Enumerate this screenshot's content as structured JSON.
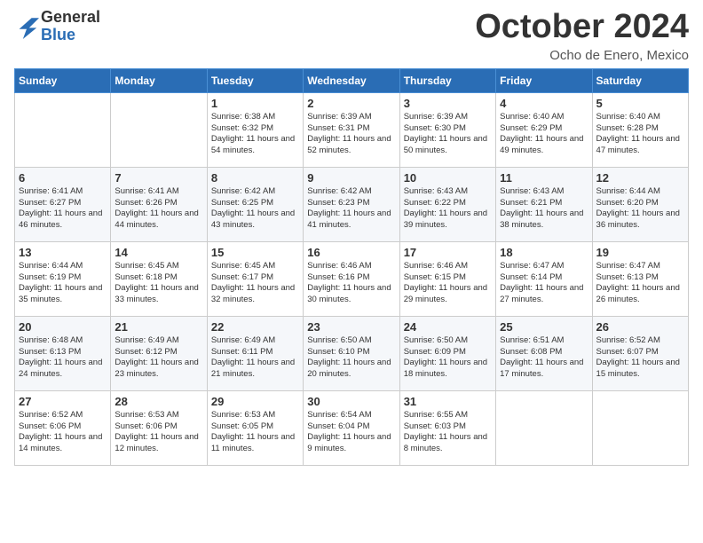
{
  "logo": {
    "general": "General",
    "blue": "Blue"
  },
  "header": {
    "month": "October 2024",
    "location": "Ocho de Enero, Mexico"
  },
  "weekdays": [
    "Sunday",
    "Monday",
    "Tuesday",
    "Wednesday",
    "Thursday",
    "Friday",
    "Saturday"
  ],
  "weeks": [
    [
      {
        "day": "",
        "sunrise": "",
        "sunset": "",
        "daylight": ""
      },
      {
        "day": "",
        "sunrise": "",
        "sunset": "",
        "daylight": ""
      },
      {
        "day": "1",
        "sunrise": "Sunrise: 6:38 AM",
        "sunset": "Sunset: 6:32 PM",
        "daylight": "Daylight: 11 hours and 54 minutes."
      },
      {
        "day": "2",
        "sunrise": "Sunrise: 6:39 AM",
        "sunset": "Sunset: 6:31 PM",
        "daylight": "Daylight: 11 hours and 52 minutes."
      },
      {
        "day": "3",
        "sunrise": "Sunrise: 6:39 AM",
        "sunset": "Sunset: 6:30 PM",
        "daylight": "Daylight: 11 hours and 50 minutes."
      },
      {
        "day": "4",
        "sunrise": "Sunrise: 6:40 AM",
        "sunset": "Sunset: 6:29 PM",
        "daylight": "Daylight: 11 hours and 49 minutes."
      },
      {
        "day": "5",
        "sunrise": "Sunrise: 6:40 AM",
        "sunset": "Sunset: 6:28 PM",
        "daylight": "Daylight: 11 hours and 47 minutes."
      }
    ],
    [
      {
        "day": "6",
        "sunrise": "Sunrise: 6:41 AM",
        "sunset": "Sunset: 6:27 PM",
        "daylight": "Daylight: 11 hours and 46 minutes."
      },
      {
        "day": "7",
        "sunrise": "Sunrise: 6:41 AM",
        "sunset": "Sunset: 6:26 PM",
        "daylight": "Daylight: 11 hours and 44 minutes."
      },
      {
        "day": "8",
        "sunrise": "Sunrise: 6:42 AM",
        "sunset": "Sunset: 6:25 PM",
        "daylight": "Daylight: 11 hours and 43 minutes."
      },
      {
        "day": "9",
        "sunrise": "Sunrise: 6:42 AM",
        "sunset": "Sunset: 6:23 PM",
        "daylight": "Daylight: 11 hours and 41 minutes."
      },
      {
        "day": "10",
        "sunrise": "Sunrise: 6:43 AM",
        "sunset": "Sunset: 6:22 PM",
        "daylight": "Daylight: 11 hours and 39 minutes."
      },
      {
        "day": "11",
        "sunrise": "Sunrise: 6:43 AM",
        "sunset": "Sunset: 6:21 PM",
        "daylight": "Daylight: 11 hours and 38 minutes."
      },
      {
        "day": "12",
        "sunrise": "Sunrise: 6:44 AM",
        "sunset": "Sunset: 6:20 PM",
        "daylight": "Daylight: 11 hours and 36 minutes."
      }
    ],
    [
      {
        "day": "13",
        "sunrise": "Sunrise: 6:44 AM",
        "sunset": "Sunset: 6:19 PM",
        "daylight": "Daylight: 11 hours and 35 minutes."
      },
      {
        "day": "14",
        "sunrise": "Sunrise: 6:45 AM",
        "sunset": "Sunset: 6:18 PM",
        "daylight": "Daylight: 11 hours and 33 minutes."
      },
      {
        "day": "15",
        "sunrise": "Sunrise: 6:45 AM",
        "sunset": "Sunset: 6:17 PM",
        "daylight": "Daylight: 11 hours and 32 minutes."
      },
      {
        "day": "16",
        "sunrise": "Sunrise: 6:46 AM",
        "sunset": "Sunset: 6:16 PM",
        "daylight": "Daylight: 11 hours and 30 minutes."
      },
      {
        "day": "17",
        "sunrise": "Sunrise: 6:46 AM",
        "sunset": "Sunset: 6:15 PM",
        "daylight": "Daylight: 11 hours and 29 minutes."
      },
      {
        "day": "18",
        "sunrise": "Sunrise: 6:47 AM",
        "sunset": "Sunset: 6:14 PM",
        "daylight": "Daylight: 11 hours and 27 minutes."
      },
      {
        "day": "19",
        "sunrise": "Sunrise: 6:47 AM",
        "sunset": "Sunset: 6:13 PM",
        "daylight": "Daylight: 11 hours and 26 minutes."
      }
    ],
    [
      {
        "day": "20",
        "sunrise": "Sunrise: 6:48 AM",
        "sunset": "Sunset: 6:13 PM",
        "daylight": "Daylight: 11 hours and 24 minutes."
      },
      {
        "day": "21",
        "sunrise": "Sunrise: 6:49 AM",
        "sunset": "Sunset: 6:12 PM",
        "daylight": "Daylight: 11 hours and 23 minutes."
      },
      {
        "day": "22",
        "sunrise": "Sunrise: 6:49 AM",
        "sunset": "Sunset: 6:11 PM",
        "daylight": "Daylight: 11 hours and 21 minutes."
      },
      {
        "day": "23",
        "sunrise": "Sunrise: 6:50 AM",
        "sunset": "Sunset: 6:10 PM",
        "daylight": "Daylight: 11 hours and 20 minutes."
      },
      {
        "day": "24",
        "sunrise": "Sunrise: 6:50 AM",
        "sunset": "Sunset: 6:09 PM",
        "daylight": "Daylight: 11 hours and 18 minutes."
      },
      {
        "day": "25",
        "sunrise": "Sunrise: 6:51 AM",
        "sunset": "Sunset: 6:08 PM",
        "daylight": "Daylight: 11 hours and 17 minutes."
      },
      {
        "day": "26",
        "sunrise": "Sunrise: 6:52 AM",
        "sunset": "Sunset: 6:07 PM",
        "daylight": "Daylight: 11 hours and 15 minutes."
      }
    ],
    [
      {
        "day": "27",
        "sunrise": "Sunrise: 6:52 AM",
        "sunset": "Sunset: 6:06 PM",
        "daylight": "Daylight: 11 hours and 14 minutes."
      },
      {
        "day": "28",
        "sunrise": "Sunrise: 6:53 AM",
        "sunset": "Sunset: 6:06 PM",
        "daylight": "Daylight: 11 hours and 12 minutes."
      },
      {
        "day": "29",
        "sunrise": "Sunrise: 6:53 AM",
        "sunset": "Sunset: 6:05 PM",
        "daylight": "Daylight: 11 hours and 11 minutes."
      },
      {
        "day": "30",
        "sunrise": "Sunrise: 6:54 AM",
        "sunset": "Sunset: 6:04 PM",
        "daylight": "Daylight: 11 hours and 9 minutes."
      },
      {
        "day": "31",
        "sunrise": "Sunrise: 6:55 AM",
        "sunset": "Sunset: 6:03 PM",
        "daylight": "Daylight: 11 hours and 8 minutes."
      },
      {
        "day": "",
        "sunrise": "",
        "sunset": "",
        "daylight": ""
      },
      {
        "day": "",
        "sunrise": "",
        "sunset": "",
        "daylight": ""
      }
    ]
  ]
}
